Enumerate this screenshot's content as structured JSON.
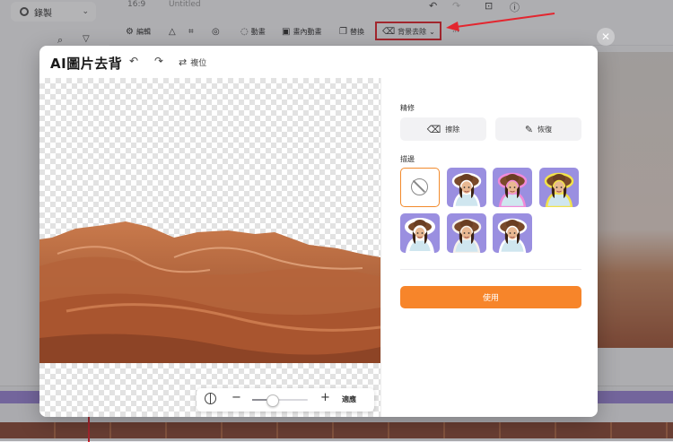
{
  "background_app": {
    "record_label": "錄製",
    "aspect_ratio": "16:9",
    "project_title": "Untitled",
    "toolbar": [
      {
        "label": "編輯",
        "icon": "sliders-icon",
        "glyph": "⚙"
      },
      {
        "label": "",
        "icon": "triangle-icon",
        "glyph": "△"
      },
      {
        "label": "",
        "icon": "crop-icon",
        "glyph": "⌗"
      },
      {
        "label": "",
        "icon": "mask-icon",
        "glyph": "◎"
      },
      {
        "label": "動畫",
        "icon": "animation-icon",
        "glyph": "◌"
      },
      {
        "label": "畫內動畫",
        "icon": "inner-animation-icon",
        "glyph": "▣"
      },
      {
        "label": "替換",
        "icon": "replace-icon",
        "glyph": "❐"
      },
      {
        "label": "背景去除",
        "icon": "eraser-icon",
        "glyph": "⌫",
        "highlighted": true
      },
      {
        "label": "···",
        "icon": "more-icon",
        "glyph": ""
      }
    ]
  },
  "modal": {
    "title": "AI圖片去背",
    "undo_icon": "undo-icon",
    "redo_icon": "redo-icon",
    "reset_label": "複位",
    "zoom": {
      "fit_label": "適應",
      "level": 0.36
    },
    "refine": {
      "label": "精修",
      "erase_label": "擦除",
      "restore_label": "恢復"
    },
    "stroke": {
      "label": "描邊",
      "options": [
        {
          "style": "none"
        },
        {
          "style": "white",
          "color": "#ffffff"
        },
        {
          "style": "pink",
          "color": "#f08ad8"
        },
        {
          "style": "yellow",
          "color": "#f2e24a"
        },
        {
          "style": "white-thick",
          "color": "#ffffff"
        },
        {
          "style": "white-soft",
          "color": "#f5f0ea"
        },
        {
          "style": "white-outline",
          "color": "#ffffff"
        }
      ]
    },
    "apply_label": "使用"
  },
  "colors": {
    "accent": "#f7852a",
    "highlight_border": "#e3262f",
    "thumb_bg": "#9a8fe0",
    "dune_dark": "#9a4e2c",
    "dune_light": "#d8895a"
  }
}
